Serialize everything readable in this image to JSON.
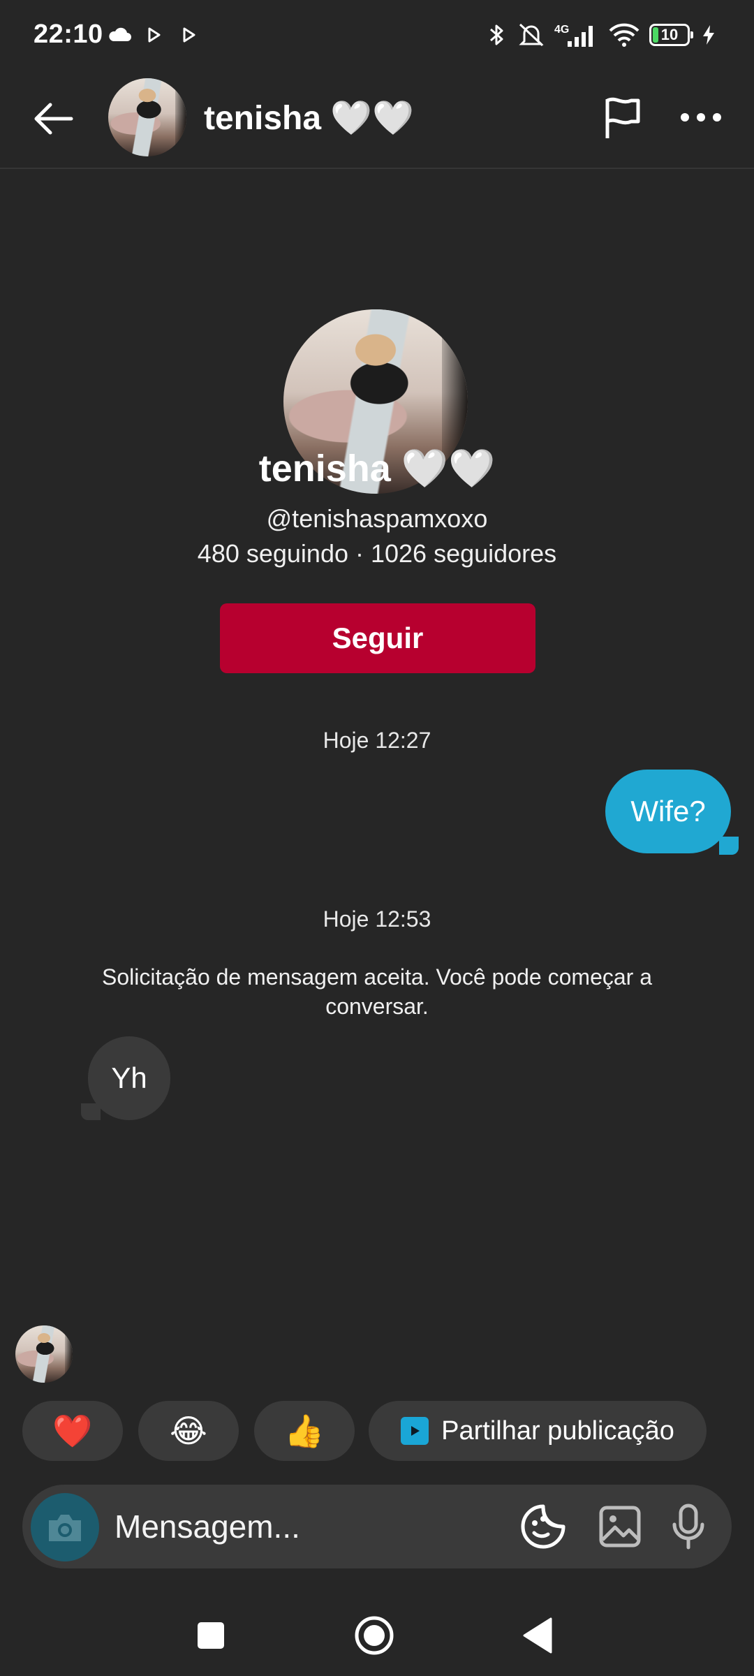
{
  "status_bar": {
    "time": "22:10",
    "network": "4G",
    "battery": "10"
  },
  "header": {
    "name": "tenisha 🤍🤍",
    "icons": [
      "back-arrow-icon",
      "flag-icon",
      "more-icon"
    ]
  },
  "profile": {
    "name": "tenisha 🤍🤍",
    "handle": "@tenishaspamxoxo",
    "stats": "480 seguindo · 1026 seguidores",
    "follow_label": "Seguir"
  },
  "conversation": {
    "timestamp_1": "Hoje 12:27",
    "sent_message": "Wife?",
    "timestamp_2": "Hoje 12:53",
    "system_message": "Solicitação de mensagem aceita. Você pode começar a conversar.",
    "received_message": "Yh"
  },
  "quick_replies": {
    "heart": "❤️",
    "laugh": "😂",
    "thumbs_up": "👍",
    "share_label": "Partilhar publicação"
  },
  "composer": {
    "placeholder": "Mensagem..."
  },
  "colors": {
    "background": "#262626",
    "follow_button": "#b7002f",
    "sent_bubble": "#20a8d2",
    "received_bubble": "#3a3a3a"
  }
}
